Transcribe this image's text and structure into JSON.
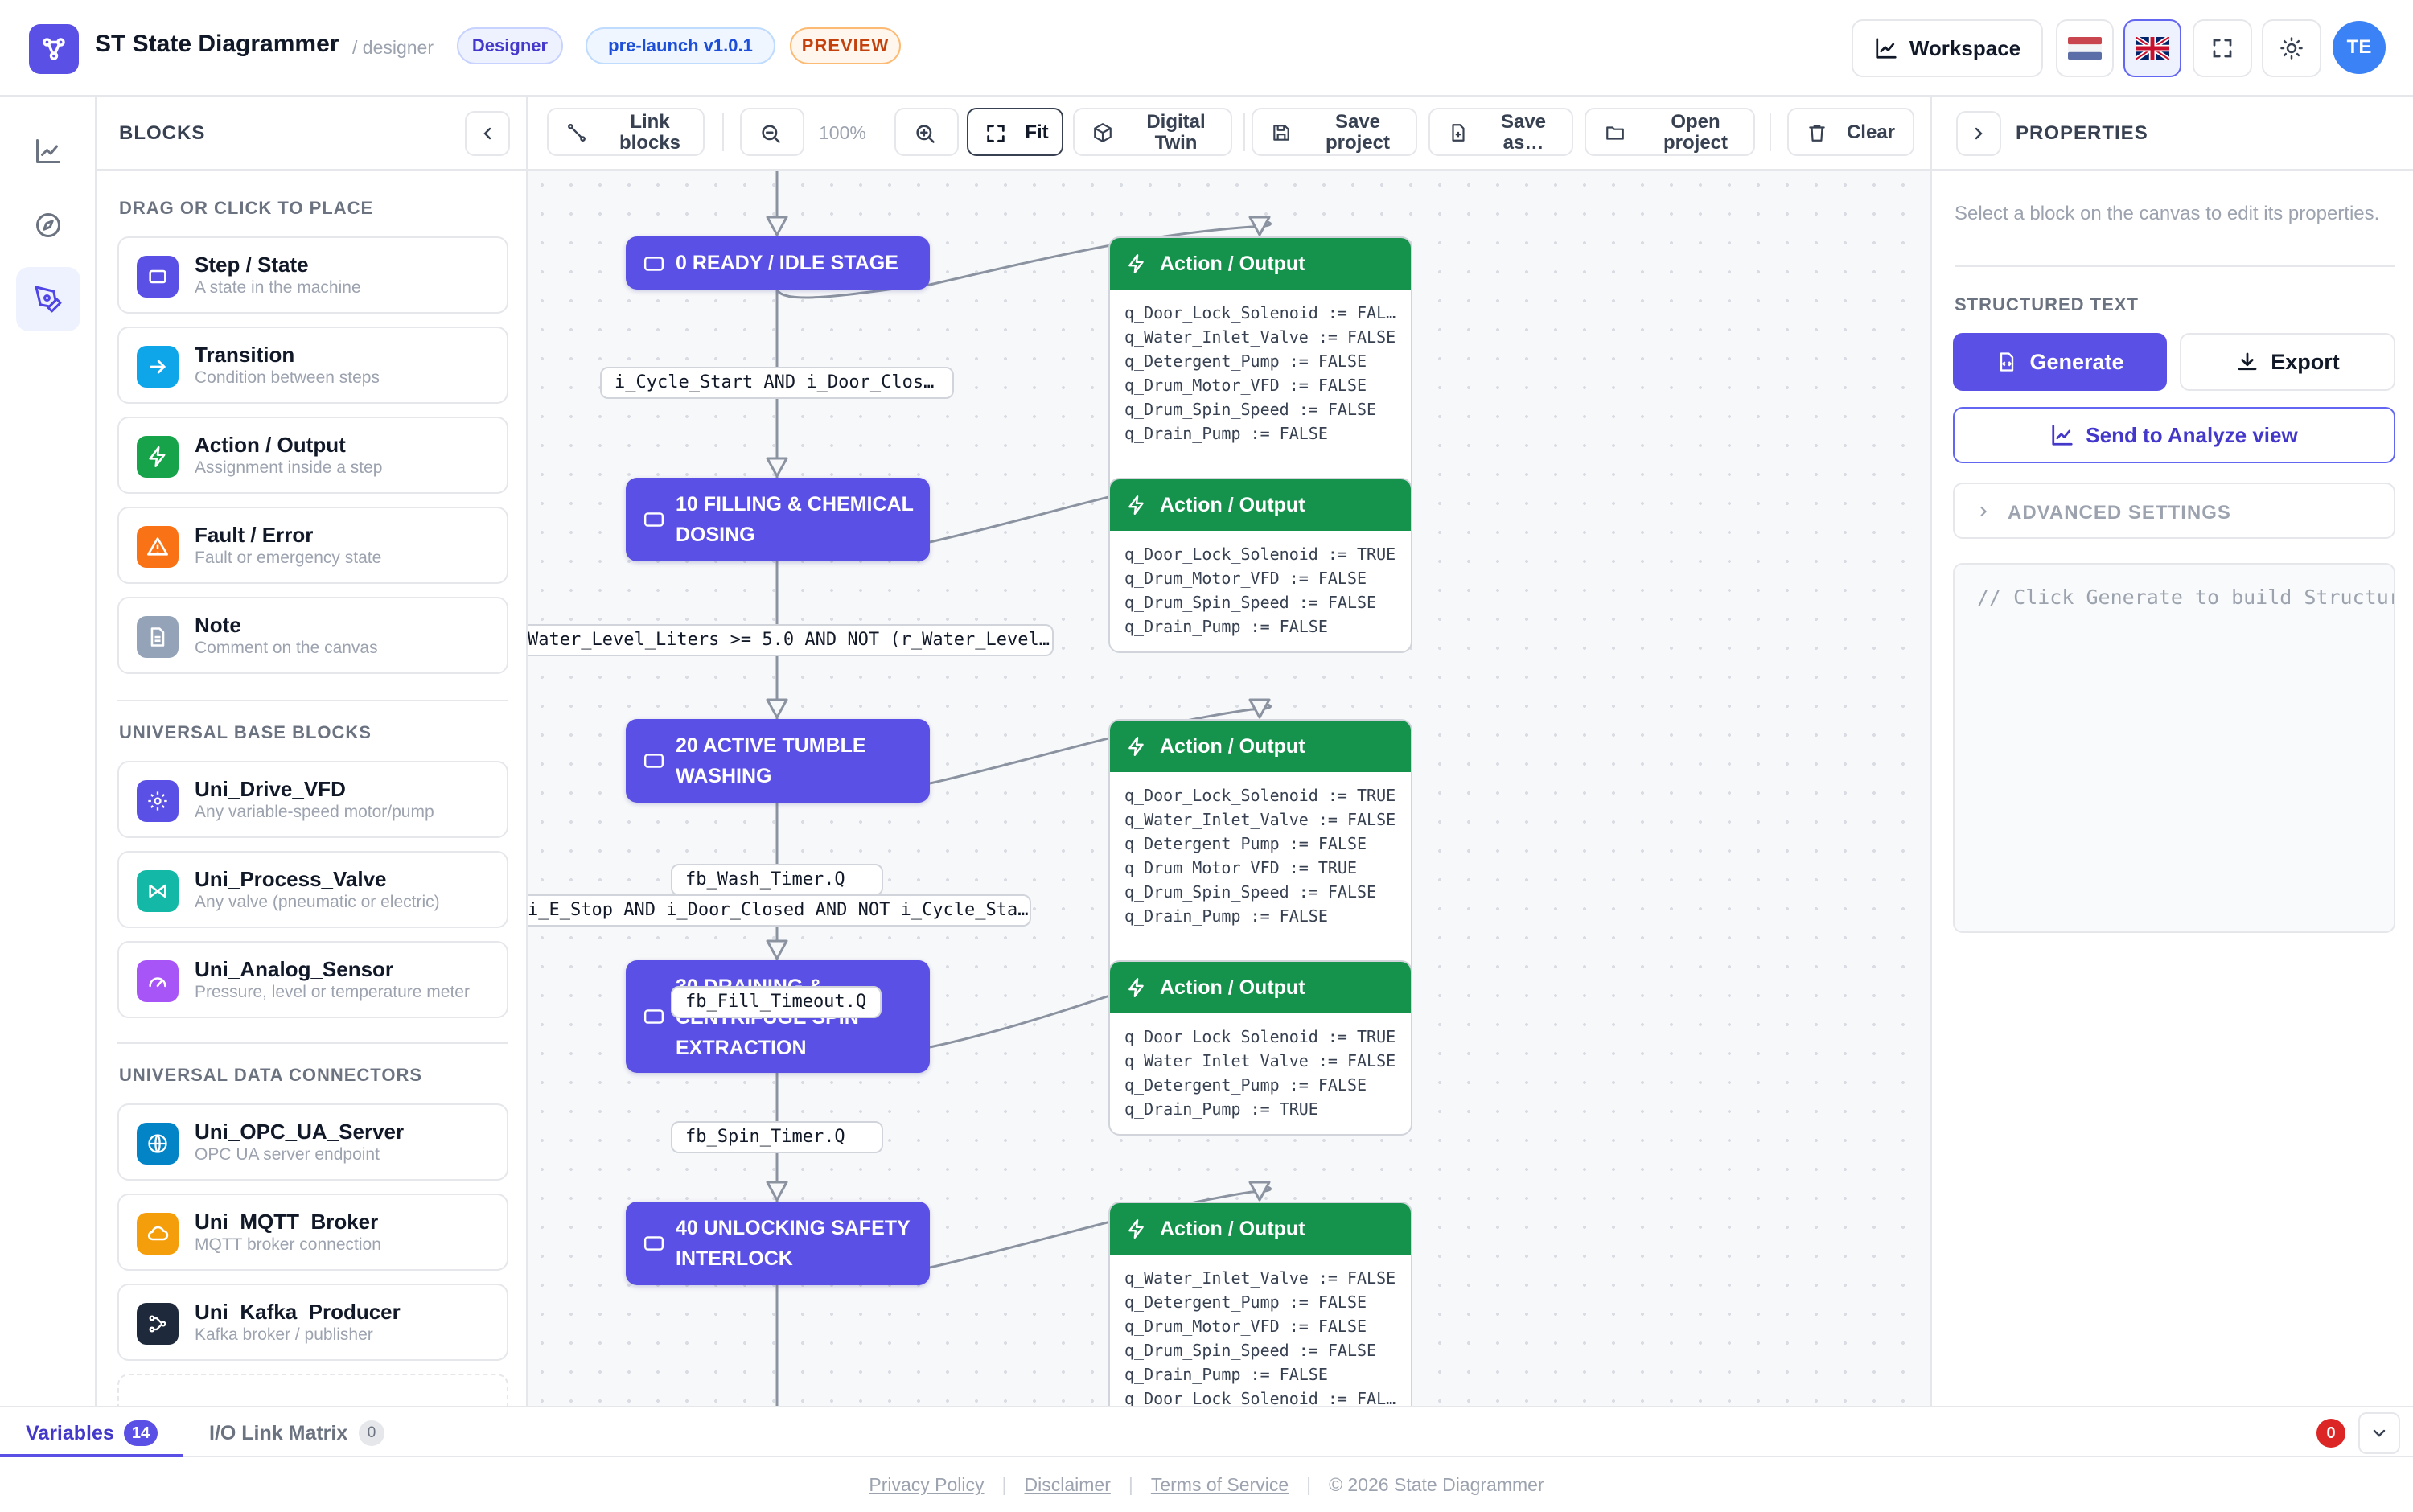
{
  "header": {
    "title": "ST State Diagrammer",
    "subtitle": "/ designer",
    "badges": {
      "designer": "Designer",
      "version": "pre-launch v1.0.1",
      "preview": "PREVIEW"
    },
    "workspace_label": "Workspace",
    "avatar_initials": "TE"
  },
  "blocks_panel": {
    "title": "BLOCKS",
    "sections": [
      {
        "title": "DRAG OR CLICK TO PLACE",
        "items": [
          {
            "name": "Step / State",
            "desc": "A state in the machine",
            "color": "#5b50e6",
            "icon": "square-icon"
          },
          {
            "name": "Transition",
            "desc": "Condition between steps",
            "color": "#0ea5e9",
            "icon": "arrow-right-icon"
          },
          {
            "name": "Action / Output",
            "desc": "Assignment inside a step",
            "color": "#16a34a",
            "icon": "bolt-icon"
          },
          {
            "name": "Fault / Error",
            "desc": "Fault or emergency state",
            "color": "#f97316",
            "icon": "warning-icon"
          },
          {
            "name": "Note",
            "desc": "Comment on the canvas",
            "color": "#94a3b8",
            "icon": "note-icon"
          }
        ]
      },
      {
        "title": "UNIVERSAL BASE BLOCKS",
        "items": [
          {
            "name": "Uni_Drive_VFD",
            "desc": "Any variable-speed motor/pump",
            "color": "#5b50e6",
            "icon": "gear-icon"
          },
          {
            "name": "Uni_Process_Valve",
            "desc": "Any valve (pneumatic or electric)",
            "color": "#14b8a6",
            "icon": "valve-icon"
          },
          {
            "name": "Uni_Analog_Sensor",
            "desc": "Pressure, level or temperature meter",
            "color": "#a855f7",
            "icon": "gauge-icon"
          }
        ]
      },
      {
        "title": "UNIVERSAL DATA CONNECTORS",
        "items": [
          {
            "name": "Uni_OPC_UA_Server",
            "desc": "OPC UA server endpoint",
            "color": "#0284c7",
            "icon": "globe-icon"
          },
          {
            "name": "Uni_MQTT_Broker",
            "desc": "MQTT broker connection",
            "color": "#f59e0b",
            "icon": "cloud-icon"
          },
          {
            "name": "Uni_Kafka_Producer",
            "desc": "Kafka broker / publisher",
            "color": "#1e293b",
            "icon": "share-icon"
          }
        ]
      }
    ]
  },
  "toolbar": {
    "link_blocks": "Link blocks",
    "zoom_level": "100%",
    "fit": "Fit",
    "digital_twin": "Digital Twin",
    "save_project": "Save project",
    "save_as": "Save as…",
    "open_project": "Open project",
    "clear": "Clear"
  },
  "canvas": {
    "steps": [
      {
        "label": "0 READY / IDLE STAGE"
      },
      {
        "label": "10 FILLING & CHEMICAL DOSING"
      },
      {
        "label": "20 ACTIVE TUMBLE WASHING"
      },
      {
        "label": "30 DRAINING & CENTRIFUGE SPIN EXTRACTION"
      },
      {
        "label": "40 UNLOCKING SAFETY INTERLOCK"
      }
    ],
    "actions": [
      {
        "title": "Action / Output",
        "lines": [
          "q_Door_Lock_Solenoid := FAL…",
          "q_Water_Inlet_Valve := FALSE",
          "q_Detergent_Pump := FALSE",
          "q_Drum_Motor_VFD := FALSE",
          "q_Drum_Spin_Speed := FALSE",
          "q_Drain_Pump := FALSE"
        ]
      },
      {
        "title": "Action / Output",
        "lines": [
          "q_Door_Lock_Solenoid := TRUE",
          "q_Drum_Motor_VFD := FALSE",
          "q_Drum_Spin_Speed := FALSE",
          "q_Drain_Pump := FALSE"
        ]
      },
      {
        "title": "Action / Output",
        "lines": [
          "q_Door_Lock_Solenoid := TRUE",
          "q_Water_Inlet_Valve := FALSE",
          "q_Detergent_Pump := FALSE",
          "q_Drum_Motor_VFD := TRUE",
          "q_Drum_Spin_Speed := FALSE",
          "q_Drain_Pump := FALSE"
        ]
      },
      {
        "title": "Action / Output",
        "lines": [
          "q_Door_Lock_Solenoid := TRUE",
          "q_Water_Inlet_Valve := FALSE",
          "q_Detergent_Pump := FALSE",
          "q_Drain_Pump := TRUE"
        ]
      },
      {
        "title": "Action / Output",
        "lines": [
          "q_Water_Inlet_Valve := FALSE",
          "q_Detergent_Pump := FALSE",
          "q_Drum_Motor_VFD := FALSE",
          "q_Drum_Spin_Speed := FALSE",
          "q_Drain_Pump := FALSE",
          "q_Door_Lock_Solenoid := FAL…"
        ]
      }
    ],
    "conditions": [
      "i_Cycle_Start AND i_Door_Clos…",
      "Water_Level_Liters >= 5.0 AND NOT (r_Water_Level…",
      "fb_Wash_Timer.Q",
      "i_E_Stop AND i_Door_Closed AND NOT i_Cycle_Sta…",
      "fb_Fill_Timeout.Q",
      "fb_Spin_Timer.Q"
    ]
  },
  "properties": {
    "title": "PROPERTIES",
    "hint": "Select a block on the canvas to edit its properties.",
    "structured_text_title": "STRUCTURED TEXT",
    "generate": "Generate",
    "export": "Export",
    "send_analyze": "Send to Analyze view",
    "advanced": "ADVANCED SETTINGS",
    "code_placeholder": "// Click Generate to build Structured Text"
  },
  "bottom_tabs": {
    "variables": "Variables",
    "variables_count": "14",
    "io_matrix": "I/O Link Matrix",
    "io_matrix_count": "0",
    "error_count": "0"
  },
  "footer": {
    "privacy": "Privacy Policy",
    "disclaimer": "Disclaimer",
    "terms": "Terms of Service",
    "copyright": "© 2026 State Diagrammer"
  },
  "colors": {
    "accent": "#5b50e6",
    "action_green": "#15934d",
    "error_red": "#dc2626"
  }
}
